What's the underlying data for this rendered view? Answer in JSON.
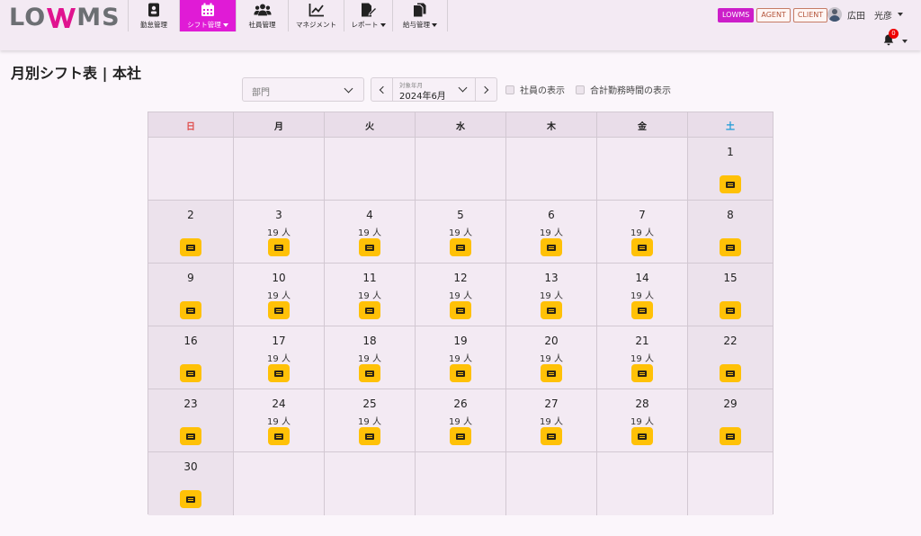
{
  "app": {
    "logo": "LOWMS",
    "nav": [
      {
        "key": "attendance",
        "label": "勤怠管理",
        "icon": "id-badge-icon",
        "active": false,
        "dropdown": false
      },
      {
        "key": "shift",
        "label": "シフト管理",
        "icon": "calendar-icon",
        "active": true,
        "dropdown": true
      },
      {
        "key": "employees",
        "label": "社員管理",
        "icon": "users-icon",
        "active": false,
        "dropdown": false
      },
      {
        "key": "management",
        "label": "マネジメント",
        "icon": "line-chart-icon",
        "active": false,
        "dropdown": false
      },
      {
        "key": "reports",
        "label": "レポート",
        "icon": "report-pen-icon",
        "active": false,
        "dropdown": true
      },
      {
        "key": "payroll",
        "label": "給与管理",
        "icon": "documents-icon",
        "active": false,
        "dropdown": true
      }
    ],
    "badges": {
      "lowms": "LOWMS",
      "agent": "AGENT",
      "client": "CLIENT"
    },
    "user_name": "広田　光彦",
    "notifications": "0",
    "accent_color": "#e01bd6"
  },
  "page": {
    "title": "月別シフト表 | 本社"
  },
  "filters": {
    "department_placeholder": "部門",
    "month_caption": "対象年月",
    "month_value": "2024年6月",
    "show_employees_label": "社員の表示",
    "show_total_hours_label": "合計勤務時間の表示"
  },
  "calendar": {
    "weekdays": [
      "日",
      "月",
      "火",
      "水",
      "木",
      "金",
      "土"
    ],
    "weeks": [
      [
        null,
        null,
        null,
        null,
        null,
        null,
        {
          "day": "1",
          "count": ""
        }
      ],
      [
        {
          "day": "2",
          "count": ""
        },
        {
          "day": "3",
          "count": "19 人"
        },
        {
          "day": "4",
          "count": "19 人"
        },
        {
          "day": "5",
          "count": "19 人"
        },
        {
          "day": "6",
          "count": "19 人"
        },
        {
          "day": "7",
          "count": "19 人"
        },
        {
          "day": "8",
          "count": ""
        }
      ],
      [
        {
          "day": "9",
          "count": ""
        },
        {
          "day": "10",
          "count": "19 人"
        },
        {
          "day": "11",
          "count": "19 人"
        },
        {
          "day": "12",
          "count": "19 人"
        },
        {
          "day": "13",
          "count": "19 人"
        },
        {
          "day": "14",
          "count": "19 人"
        },
        {
          "day": "15",
          "count": ""
        }
      ],
      [
        {
          "day": "16",
          "count": ""
        },
        {
          "day": "17",
          "count": "19 人"
        },
        {
          "day": "18",
          "count": "19 人"
        },
        {
          "day": "19",
          "count": "19 人"
        },
        {
          "day": "20",
          "count": "19 人"
        },
        {
          "day": "21",
          "count": "19 人"
        },
        {
          "day": "22",
          "count": ""
        }
      ],
      [
        {
          "day": "23",
          "count": ""
        },
        {
          "day": "24",
          "count": "19 人"
        },
        {
          "day": "25",
          "count": "19 人"
        },
        {
          "day": "26",
          "count": "19 人"
        },
        {
          "day": "27",
          "count": "19 人"
        },
        {
          "day": "28",
          "count": "19 人"
        },
        {
          "day": "29",
          "count": ""
        }
      ],
      [
        {
          "day": "30",
          "count": ""
        },
        null,
        null,
        null,
        null,
        null,
        null
      ]
    ],
    "detail_button_icon": "list-icon",
    "detail_button_color": "#ffc107"
  }
}
